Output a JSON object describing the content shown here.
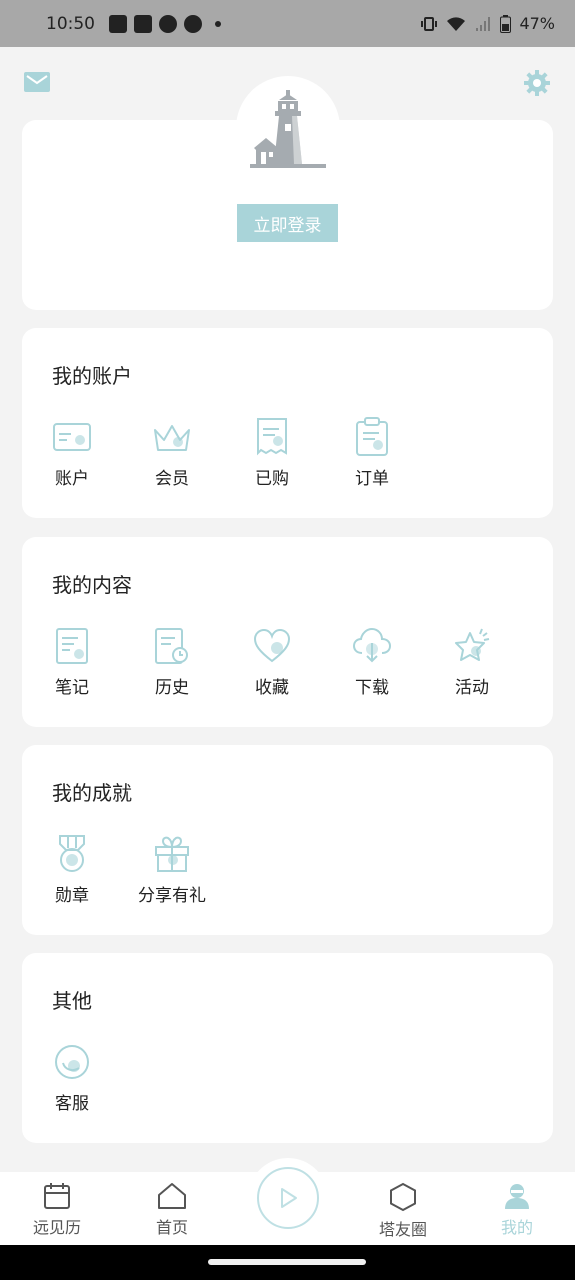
{
  "status_bar": {
    "time": "10:50",
    "battery": "47%"
  },
  "login": {
    "button_label": "立即登录"
  },
  "account": {
    "title": "我的账户",
    "items": [
      {
        "label": "账户",
        "icon": "card-icon"
      },
      {
        "label": "会员",
        "icon": "crown-icon"
      },
      {
        "label": "已购",
        "icon": "receipt-icon"
      },
      {
        "label": "订单",
        "icon": "clipboard-icon"
      }
    ]
  },
  "content": {
    "title": "我的内容",
    "items": [
      {
        "label": "笔记",
        "icon": "note-icon"
      },
      {
        "label": "历史",
        "icon": "history-icon"
      },
      {
        "label": "收藏",
        "icon": "heart-icon"
      },
      {
        "label": "下载",
        "icon": "cloud-download-icon"
      },
      {
        "label": "活动",
        "icon": "star-icon"
      }
    ]
  },
  "achievements": {
    "title": "我的成就",
    "items": [
      {
        "label": "勋章",
        "icon": "medal-icon"
      },
      {
        "label": "分享有礼",
        "icon": "gift-icon"
      }
    ]
  },
  "other": {
    "title": "其他",
    "items": [
      {
        "label": "客服",
        "icon": "support-icon"
      }
    ]
  },
  "bottom_nav": {
    "items": [
      {
        "label": "远见历",
        "icon": "calendar-icon"
      },
      {
        "label": "首页",
        "icon": "home-icon"
      },
      {
        "label": "塔友圈",
        "icon": "hexagon-icon"
      },
      {
        "label": "我的",
        "icon": "profile-icon",
        "active": true
      }
    ]
  },
  "colors": {
    "accent": "#a9d4d9",
    "background": "#f3f3f3"
  }
}
